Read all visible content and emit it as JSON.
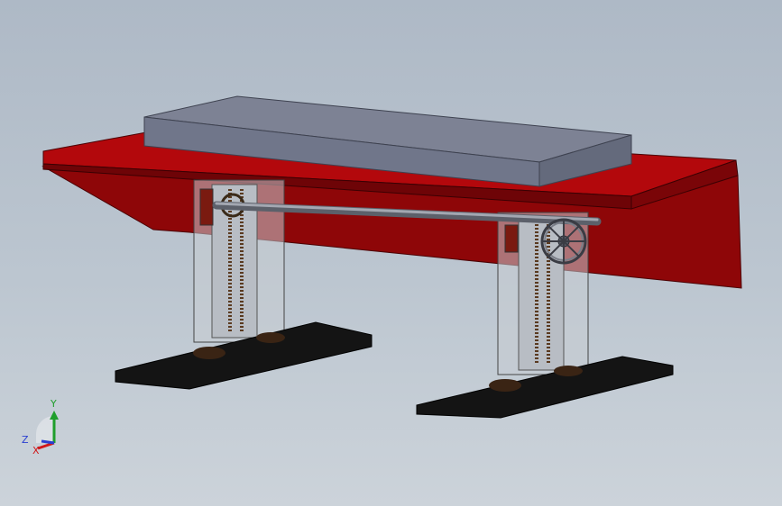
{
  "viewport": {
    "background_top": "#aeb9c6",
    "background_bottom": "#ccd3da"
  },
  "model": {
    "parts": [
      "table-top",
      "front-panel",
      "stone-slab",
      "left-leg",
      "right-leg",
      "drive-shaft",
      "handwheel",
      "left-foot",
      "right-foot"
    ],
    "colors": {
      "table_top": "#b3080c",
      "table_edge": "#6e0407",
      "slab_top": "#7d8294",
      "slab_side": "#646a7c",
      "leg_glass": "#c7ccd2",
      "foot": "#141414",
      "shaft": "#8a8e99"
    }
  },
  "triad": {
    "y_label": "Y",
    "z_label": "Z",
    "x_label": "X",
    "y_color": "#1f9e2c",
    "x_color": "#d0181a",
    "z_color": "#2a3fd0"
  }
}
